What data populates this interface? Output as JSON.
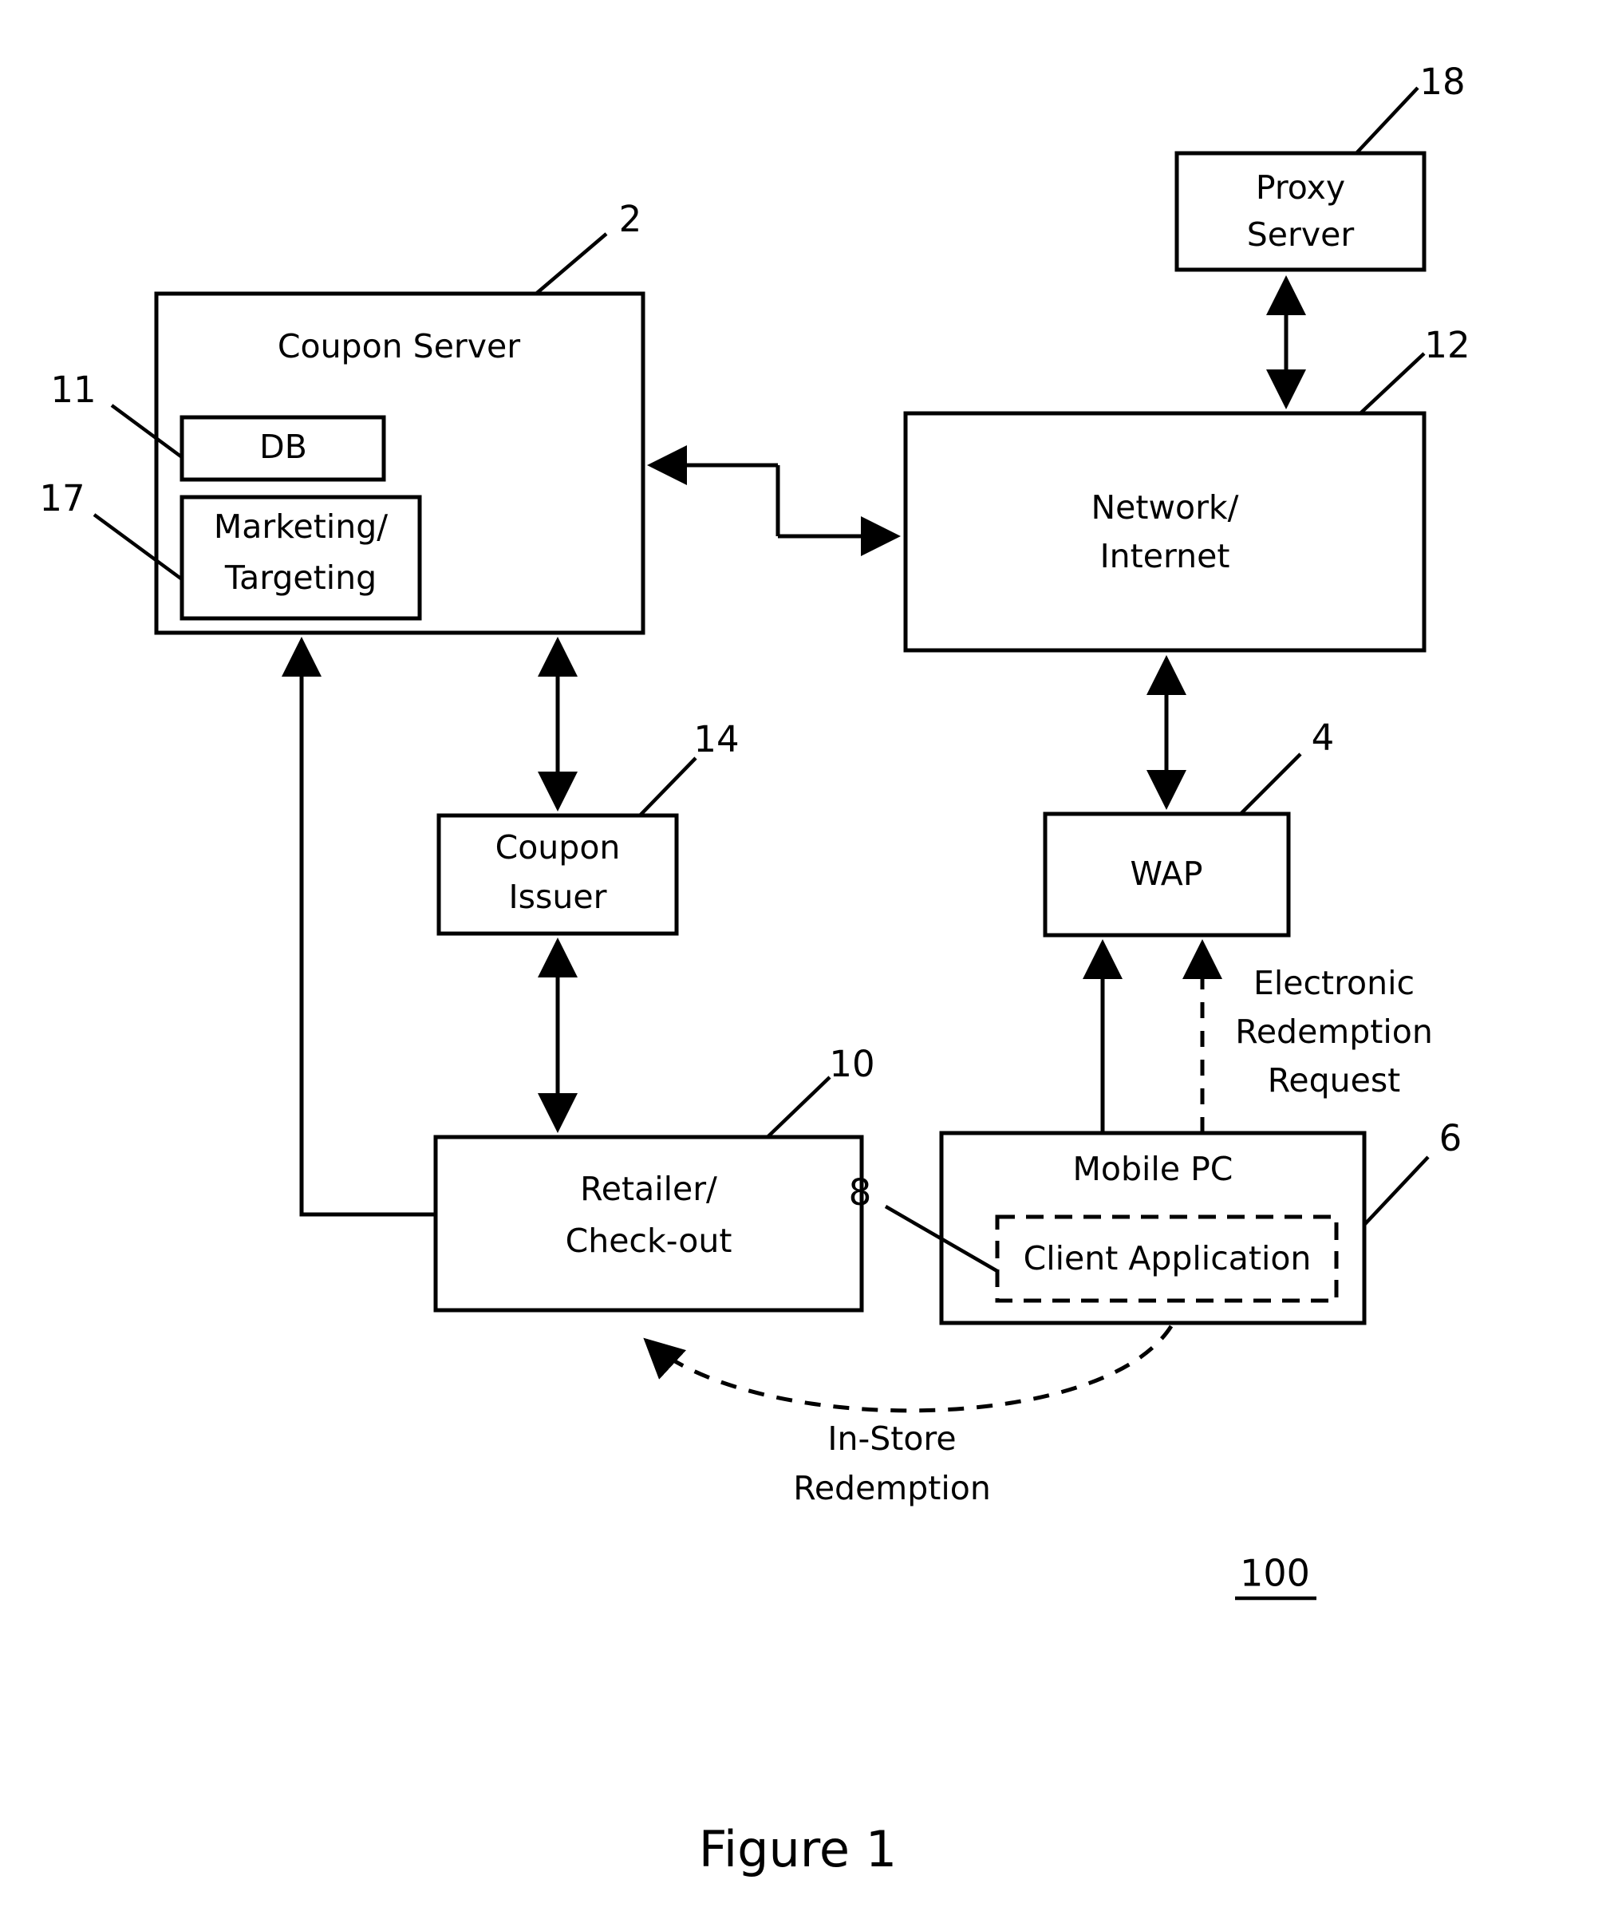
{
  "figure": {
    "caption": "Figure 1",
    "system_label": "100"
  },
  "nodes": {
    "coupon_server": {
      "label": "Coupon Server",
      "ref": "2"
    },
    "db": {
      "label": "DB",
      "ref": "11"
    },
    "marketing": {
      "label_line1": "Marketing/",
      "label_line2": "Targeting",
      "ref": "17"
    },
    "proxy_server": {
      "label_line1": "Proxy",
      "label_line2": "Server",
      "ref": "18"
    },
    "network": {
      "label_line1": "Network/",
      "label_line2": "Internet",
      "ref": "12"
    },
    "coupon_issuer": {
      "label_line1": "Coupon",
      "label_line2": "Issuer",
      "ref": "14"
    },
    "wap": {
      "label": "WAP",
      "ref": "4"
    },
    "retailer": {
      "label_line1": "Retailer/",
      "label_line2": "Check-out",
      "ref": "10"
    },
    "mobile_pc": {
      "label": "Mobile PC",
      "ref": "6"
    },
    "client_application": {
      "label": "Client Application",
      "ref": "8"
    }
  },
  "annotations": {
    "electronic_redemption": {
      "line1": "Electronic",
      "line2": "Redemption",
      "line3": "Request"
    },
    "in_store_redemption": {
      "line1": "In-Store",
      "line2": "Redemption"
    }
  },
  "colors": {
    "stroke": "#000000",
    "fill": "#ffffff"
  }
}
